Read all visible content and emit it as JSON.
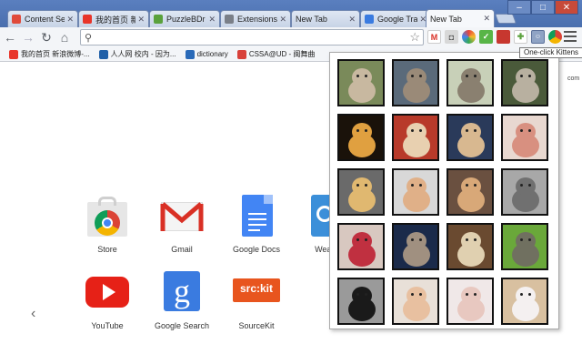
{
  "tabs": [
    {
      "label": "Content Se",
      "icon": "chrome-icon",
      "color": "#e04a3a",
      "active": false
    },
    {
      "label": "我的首页 新",
      "icon": "weibo-icon",
      "color": "#e8352a",
      "active": false
    },
    {
      "label": "PuzzleBDr",
      "icon": "puzzle-icon",
      "color": "#5aa13c",
      "active": false
    },
    {
      "label": "Extensions",
      "icon": "extensions-icon",
      "color": "#7a7f88",
      "active": false
    },
    {
      "label": "New Tab",
      "icon": "none",
      "color": "#ffffff",
      "active": false
    },
    {
      "label": "Google Tra",
      "icon": "google-translate-icon",
      "color": "#3a7be0",
      "active": false
    },
    {
      "label": "New Tab",
      "icon": "none",
      "color": "#ffffff",
      "active": true
    }
  ],
  "bookmarks": [
    {
      "label": "我的首页 新浪微博-...",
      "icon": "weibo-icon",
      "color": "#e8352a"
    },
    {
      "label": "人人网 校内 - 因为...",
      "icon": "renren-icon",
      "color": "#1f5fa8"
    },
    {
      "label": "dictionary",
      "icon": "dictionary-icon",
      "color": "#2a6ab8"
    },
    {
      "label": "CSSA@UD - 闽舞曲",
      "icon": "cssa-icon",
      "color": "#d8413a"
    }
  ],
  "apps": [
    {
      "label": "Store",
      "icon": "store-icon"
    },
    {
      "label": "Gmail",
      "icon": "gmail-icon"
    },
    {
      "label": "Google Docs",
      "icon": "google-docs-icon"
    },
    {
      "label": "Weather",
      "icon": "weather-icon"
    },
    {
      "label": "YouTube",
      "icon": "youtube-icon"
    },
    {
      "label": "Google Search",
      "icon": "google-search-icon"
    },
    {
      "label": "SourceKit",
      "icon": "sourcekit-icon"
    }
  ],
  "sourcekit_logo": "src:kit",
  "tooltip": "One-click Kittens",
  "ntp_corner_text": "com",
  "kittens": [
    {
      "icon": "kitten-photo-icon",
      "bg": "#7a8a5a",
      "fur": "#c8b8a0"
    },
    {
      "icon": "kitten-photo-icon",
      "bg": "#5a6a7a",
      "fur": "#9a8a78"
    },
    {
      "icon": "kitten-photo-icon",
      "bg": "#c8d0b8",
      "fur": "#8a8070"
    },
    {
      "icon": "kitten-photo-icon",
      "bg": "#4a5a3a",
      "fur": "#b8b0a0"
    },
    {
      "icon": "kitten-photo-icon",
      "bg": "#1a120a",
      "fur": "#e0a040"
    },
    {
      "icon": "kitten-photo-icon",
      "bg": "#b83a2a",
      "fur": "#e8d0b0"
    },
    {
      "icon": "kitten-photo-icon",
      "bg": "#2a3a5a",
      "fur": "#d8b890"
    },
    {
      "icon": "kitten-photo-icon",
      "bg": "#e8d8d0",
      "fur": "#d89080"
    },
    {
      "icon": "kitten-photo-icon",
      "bg": "#6a6a6a",
      "fur": "#e0b870"
    },
    {
      "icon": "kitten-photo-icon",
      "bg": "#d8d8d8",
      "fur": "#e0b088"
    },
    {
      "icon": "kitten-photo-icon",
      "bg": "#6a5040",
      "fur": "#d8a878"
    },
    {
      "icon": "kitten-photo-icon",
      "bg": "#a8a8a8",
      "fur": "#707070"
    },
    {
      "icon": "kitten-photo-icon",
      "bg": "#d8c8c0",
      "fur": "#c03040"
    },
    {
      "icon": "kitten-photo-icon",
      "bg": "#1a2a4a",
      "fur": "#a09080"
    },
    {
      "icon": "kitten-photo-icon",
      "bg": "#6a4a30",
      "fur": "#e0d0b0"
    },
    {
      "icon": "kitten-photo-icon",
      "bg": "#6aa83a",
      "fur": "#707060"
    },
    {
      "icon": "kitten-photo-icon",
      "bg": "#9a9a9a",
      "fur": "#1a1a1a"
    },
    {
      "icon": "kitten-photo-icon",
      "bg": "#e8e0d8",
      "fur": "#e8c0a0"
    },
    {
      "icon": "kitten-photo-icon",
      "bg": "#f0e8e8",
      "fur": "#e8c8c0"
    },
    {
      "icon": "kitten-photo-icon",
      "bg": "#d8c0a0",
      "fur": "#f4f0f0"
    }
  ]
}
